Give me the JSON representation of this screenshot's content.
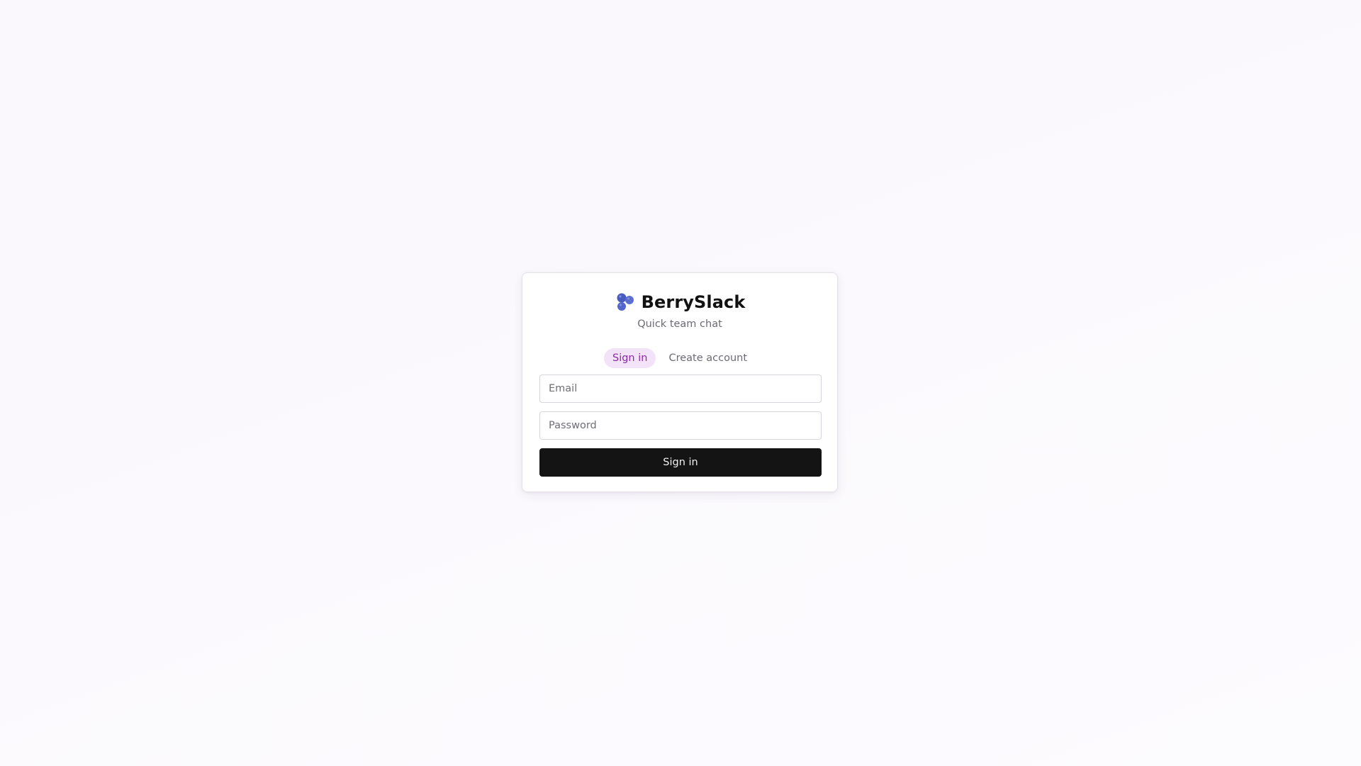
{
  "app": {
    "name": "BerrySlack",
    "tagline": "Quick team chat",
    "logo_icon": "blueberry-icon",
    "colors": {
      "accent": "#8b2aa8",
      "accent_bg": "#f3e3f8",
      "berry": "#4f5fc4",
      "button": "#141414"
    }
  },
  "auth": {
    "tabs": [
      {
        "label": "Sign in",
        "active": true
      },
      {
        "label": "Create account",
        "active": false
      }
    ],
    "email": {
      "placeholder": "Email",
      "value": ""
    },
    "password": {
      "placeholder": "Password",
      "value": ""
    },
    "submit_label": "Sign in"
  }
}
